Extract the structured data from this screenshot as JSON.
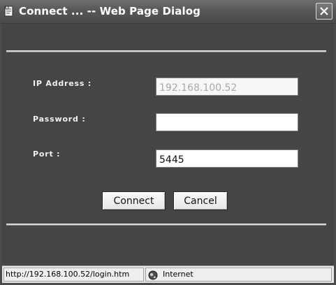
{
  "window": {
    "title": "Connect ... -- Web Page Dialog"
  },
  "form": {
    "ip_label": "IP Address  :",
    "ip_value": "192.168.100.52",
    "password_label": "Password :",
    "password_value": "",
    "port_label": "Port :",
    "port_value": "5445"
  },
  "buttons": {
    "connect_label": "Connect",
    "cancel_label": "Cancel"
  },
  "statusbar": {
    "url": "http://192.168.100.52/login.htm",
    "zone": "Internet"
  },
  "icons": {
    "title": "ie-page-icon",
    "close": "close-icon",
    "zone": "globe-icon"
  },
  "colors": {
    "window_bg": "#4b4b4b",
    "titlebar": "#575757",
    "divider": "#d9d9d9",
    "disabled_text": "#a9a9a9"
  }
}
